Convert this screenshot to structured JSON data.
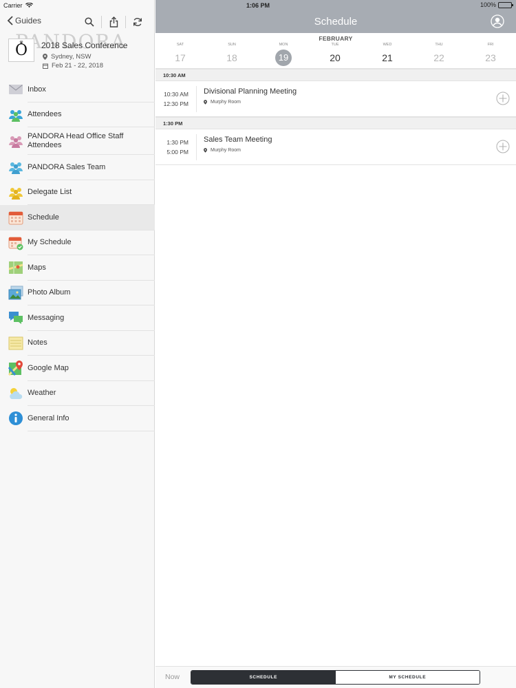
{
  "status_bar": {
    "carrier": "Carrier",
    "time": "1:06 PM",
    "battery": "100%"
  },
  "sidebar": {
    "back_label": "Guides",
    "brand_watermark": "PANDORA",
    "event": {
      "logo_text": "O",
      "title": "2018 Sales Conference",
      "location": "Sydney, NSW",
      "dates": "Feb 21 - 22, 2018"
    },
    "menu": [
      {
        "label": "Inbox",
        "icon": "inbox-icon"
      },
      {
        "label": "Attendees",
        "icon": "attendees-icon"
      },
      {
        "label": "PANDORA Head Office Staff Attendees",
        "icon": "staff-attendees-icon"
      },
      {
        "label": "PANDORA Sales Team",
        "icon": "sales-team-icon"
      },
      {
        "label": "Delegate List",
        "icon": "delegate-list-icon"
      },
      {
        "label": "Schedule",
        "icon": "calendar-icon"
      },
      {
        "label": "My Schedule",
        "icon": "my-schedule-icon"
      },
      {
        "label": "Maps",
        "icon": "map-icon"
      },
      {
        "label": "Photo Album",
        "icon": "photo-album-icon"
      },
      {
        "label": "Messaging",
        "icon": "messaging-icon"
      },
      {
        "label": "Notes",
        "icon": "notes-icon"
      },
      {
        "label": "Google Map",
        "icon": "google-map-icon"
      },
      {
        "label": "Weather",
        "icon": "weather-icon"
      },
      {
        "label": "General Info",
        "icon": "info-icon"
      }
    ]
  },
  "main": {
    "title": "Schedule",
    "month": "FEBRUARY",
    "days": [
      {
        "name": "SAT",
        "num": "17"
      },
      {
        "name": "SUN",
        "num": "18"
      },
      {
        "name": "MON",
        "num": "19"
      },
      {
        "name": "TUE",
        "num": "20"
      },
      {
        "name": "WED",
        "num": "21"
      },
      {
        "name": "THU",
        "num": "22"
      },
      {
        "name": "FRI",
        "num": "23"
      }
    ],
    "sections": [
      {
        "header": "10:30 AM",
        "event": {
          "start": "10:30 AM",
          "end": "12:30 PM",
          "title": "Divisional Planning Meeting",
          "location": "Murphy Room"
        }
      },
      {
        "header": "1:30 PM",
        "event": {
          "start": "1:30 PM",
          "end": "5:00 PM",
          "title": "Sales Team Meeting",
          "location": "Murphy Room"
        }
      }
    ],
    "bottom": {
      "now_label": "Now",
      "tab_schedule": "SCHEDULE",
      "tab_my_schedule": "MY SCHEDULE"
    }
  },
  "colors": {
    "navbar": "#a7acb3",
    "selected_day": "#a1a6ac",
    "segment_dark": "#2d3035",
    "active_row": "#e9e9e9"
  }
}
